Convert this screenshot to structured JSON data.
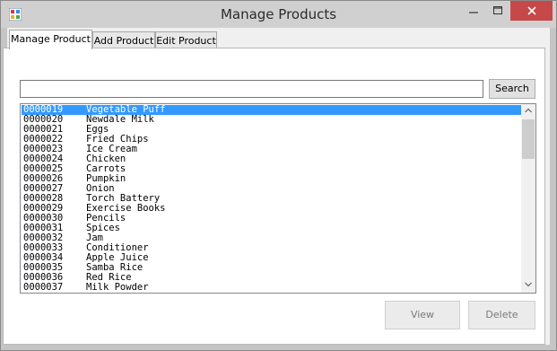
{
  "window": {
    "title": "Manage Products",
    "minimize_icon": "minimize-icon",
    "maximize_icon": "maximize-icon",
    "close_icon": "close-icon",
    "close_color": "#c74848"
  },
  "tabs": [
    {
      "label": "Manage Product",
      "active": true
    },
    {
      "label": "Add Product",
      "active": false
    },
    {
      "label": "Edit Product",
      "active": false
    }
  ],
  "search": {
    "value": "",
    "placeholder": "",
    "button_label": "Search"
  },
  "products": [
    {
      "id": "0000019",
      "name": "Vegetable Puff",
      "selected": true
    },
    {
      "id": "0000020",
      "name": "Newdale Milk"
    },
    {
      "id": "0000021",
      "name": "Eggs"
    },
    {
      "id": "0000022",
      "name": "Fried Chips"
    },
    {
      "id": "0000023",
      "name": "Ice Cream"
    },
    {
      "id": "0000024",
      "name": "Chicken"
    },
    {
      "id": "0000025",
      "name": "Carrots"
    },
    {
      "id": "0000026",
      "name": "Pumpkin"
    },
    {
      "id": "0000027",
      "name": "Onion"
    },
    {
      "id": "0000028",
      "name": "Torch Battery"
    },
    {
      "id": "0000029",
      "name": "Exercise Books"
    },
    {
      "id": "0000030",
      "name": "Pencils"
    },
    {
      "id": "0000031",
      "name": "Spices"
    },
    {
      "id": "0000032",
      "name": "Jam"
    },
    {
      "id": "0000033",
      "name": "Conditioner"
    },
    {
      "id": "0000034",
      "name": "Apple Juice"
    },
    {
      "id": "0000035",
      "name": "Samba Rice"
    },
    {
      "id": "0000036",
      "name": "Red Rice"
    },
    {
      "id": "0000037",
      "name": "Milk Powder"
    }
  ],
  "actions": {
    "view_label": "View",
    "delete_label": "Delete"
  },
  "colors": {
    "selection": "#3399ff",
    "close_button": "#c74848"
  }
}
